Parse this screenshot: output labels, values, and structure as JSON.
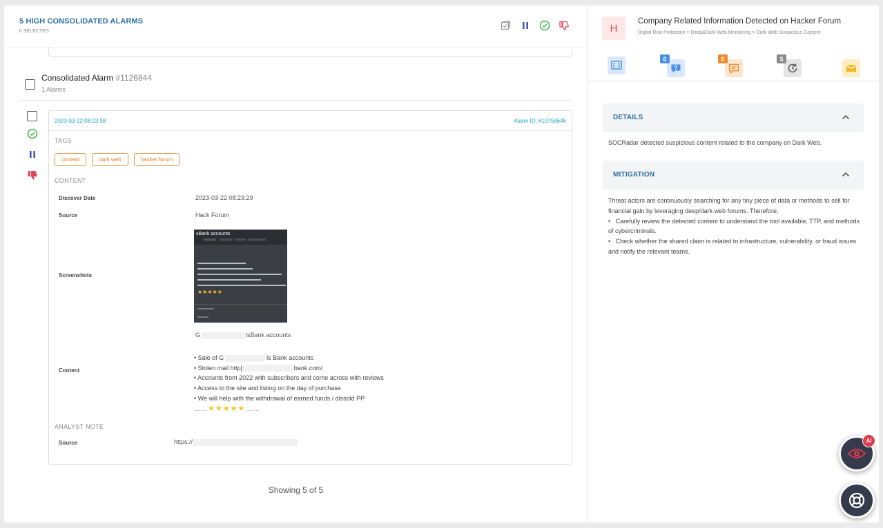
{
  "left_header": {
    "title": "5 HIGH CONSOLIDATED ALARMS",
    "selected": "0 SELECTED",
    "actions": [
      "select-all-icon",
      "pause-icon",
      "resolve-check-icon",
      "false-positive-thumb-icon"
    ]
  },
  "consolidated": {
    "title": "Consolidated Alarm",
    "id": "#1126844",
    "count": "1 Alarms"
  },
  "alarm": {
    "date": "2023-03-22 08:23:58",
    "alarm_id": "Alarm ID: #13758646",
    "tags_label": "TAGS",
    "tags": [
      "content",
      "dark web",
      "hacker forum"
    ],
    "content_label": "CONTENT",
    "discover_date_label": "Discover Date",
    "discover_date": "2023-03-22 08:23:29",
    "source_label": "Source",
    "source": "Hack Forum",
    "screenshots_label": "Screenshots",
    "screenshot_title": "sBank accounts",
    "content_row_label": "Content",
    "content_heading_a": "G",
    "content_heading_b": "lsBank accounts",
    "content_lines": {
      "l1a": "• Sale of G",
      "l1b": "ls Bank accounts",
      "l2a": "• Stolen mail http[:",
      "l2b": "bank.com/",
      "l3": "• Accounts from 2022 with subscribers and come across with reviews",
      "l4": "• Access to the site and listing on the day of purchase",
      "l5": "• We will help with the withdrawal of earned funds / dissold PP",
      "l6_stars": "★★★★★"
    },
    "analyst_note_label": "ANALYST NOTE",
    "note_source_label": "Source",
    "note_source": "https://"
  },
  "showing": "Showing 5 of 5",
  "right": {
    "badge": "H",
    "title": "Company Related Information Detected on Hacker Forum",
    "breadcrumb": "Digital Risk Protection > Deep&Dark Web Monitoring > Dark Web Suspicious Content",
    "tabs": [
      {
        "icon": "screen-icon",
        "badge": ""
      },
      {
        "icon": "question-chat-icon",
        "badge": "0"
      },
      {
        "icon": "comment-icon",
        "badge": "0"
      },
      {
        "icon": "history-icon",
        "badge": "5"
      },
      {
        "icon": "mail-icon",
        "badge": ""
      }
    ],
    "details_title": "DETAILS",
    "details_text": "SOCRadar detected suspicious content related to the company on Dark Web.",
    "mitigation_title": "MITIGATION",
    "mitigation_text": "Threat actors are continuously searching for any tiny piece of data or methods to sell for financial gain by leveraging deep/dark web forums. Therefore,",
    "mitigation_b1": "Carefully review the detected content to understand the tool available, TTP, and methods of cybercriminals.",
    "mitigation_b2": "Check whether the shared claim is related to infrastructure, vulnerability, or fraud issues and notify the relevant teams."
  },
  "fab_ai_badge": "AI",
  "colors": {
    "accent_blue": "#2a6fa8",
    "link_cyan": "#20a0c8",
    "tag_orange": "#e0953a",
    "badge_red": "#e14a4a",
    "tab_blue": "#4a90e2",
    "tab_orange": "#ef8a2b",
    "tab_gray": "#8a8a8a",
    "tab_yellow": "#f4b522"
  }
}
